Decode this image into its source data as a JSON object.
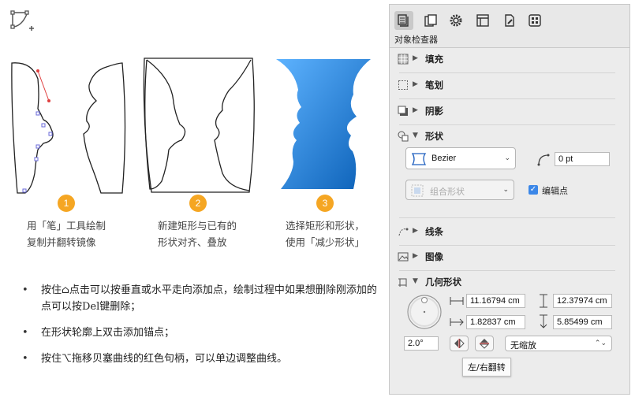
{
  "steps": [
    {
      "number": "1",
      "caption_line1": "用「笔」工具绘制",
      "caption_line2": "复制并翻转镜像"
    },
    {
      "number": "2",
      "caption_line1": "新建矩形与已有的",
      "caption_line2": "形状对齐、叠放"
    },
    {
      "number": "3",
      "caption_line1": "选择矩形和形状，",
      "caption_line2": "使用「减少形状」"
    }
  ],
  "bullets": [
    "按住⌂点击可以按垂直或水平走向添加点，绘制过程中如果想删除刚添加的点可以按Del键删除；",
    "在形状轮廓上双击添加锚点；",
    "按住⌥拖移贝塞曲线的红色句柄，可以单边调整曲线。"
  ],
  "inspector": {
    "title": "对象检查器",
    "sections": {
      "fill": "填充",
      "stroke": "笔划",
      "shadow": "阴影",
      "shape": "形状",
      "lines": "线条",
      "image": "图像",
      "geometry": "几何形状"
    },
    "shape": {
      "type_value": "Bezier",
      "corner_radius": "0 pt",
      "combine_placeholder": "组合形状",
      "edit_points_label": "编辑点",
      "edit_points_checked": true
    },
    "geometry": {
      "width": "11.16794 cm",
      "height": "12.37974 cm",
      "x": "1.82837 cm",
      "y": "5.85499 cm",
      "rotation": "2.0°",
      "scale_option": "无缩放",
      "flip_tooltip": "左/右翻转"
    }
  }
}
